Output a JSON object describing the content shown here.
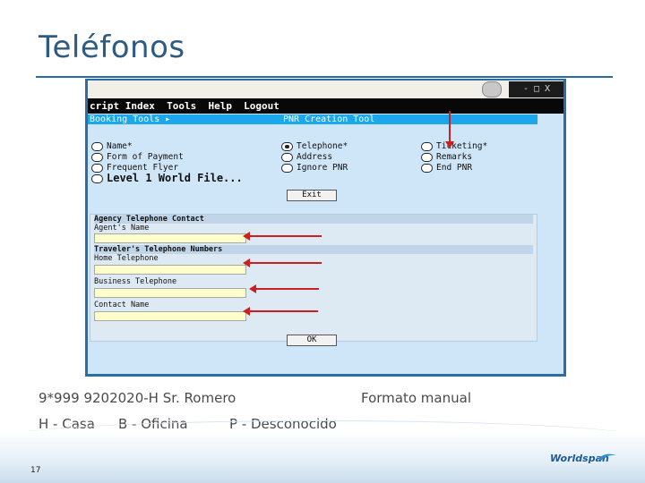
{
  "slide": {
    "title": "Teléfonos",
    "caption_example": "9*999 9202020-H Sr. Romero",
    "caption_format": "Formato manual",
    "caption_codes": [
      "H - Casa",
      "B - Oficina",
      "P - Desconocido"
    ],
    "page_number": "17",
    "brand": "Worldspan"
  },
  "window": {
    "buttons": "- □ X",
    "menu": "cript Index  Tools  Help  Logout",
    "toolbar_left": "Booking Tools ▸",
    "toolbar_right": "PNR Creation Tool"
  },
  "options": {
    "col1": [
      "Name*",
      "Form of Payment",
      "Frequent Flyer"
    ],
    "col2": [
      "Telephone*",
      "Address",
      "Ignore PNR"
    ],
    "col3": [
      "Ticketing*",
      "Remarks",
      "End PNR"
    ],
    "level": "Level 1 World File...",
    "selected": "Telephone*"
  },
  "buttons": {
    "exit": "Exit",
    "ok": "OK"
  },
  "form": {
    "agency_header": "Agency Telephone Contact",
    "agent_name_label": "Agent's Name",
    "traveler_header": "Traveler's Telephone Numbers",
    "home_label": "Home Telephone",
    "business_label": "Business Telephone",
    "contact_label": "Contact Name"
  },
  "colors": {
    "title": "#2d5b86",
    "window_bg": "#cfe6f8",
    "toolbar": "#1aa7ec",
    "input_fill": "#ffffcc",
    "arrow": "#cc1f1f"
  }
}
